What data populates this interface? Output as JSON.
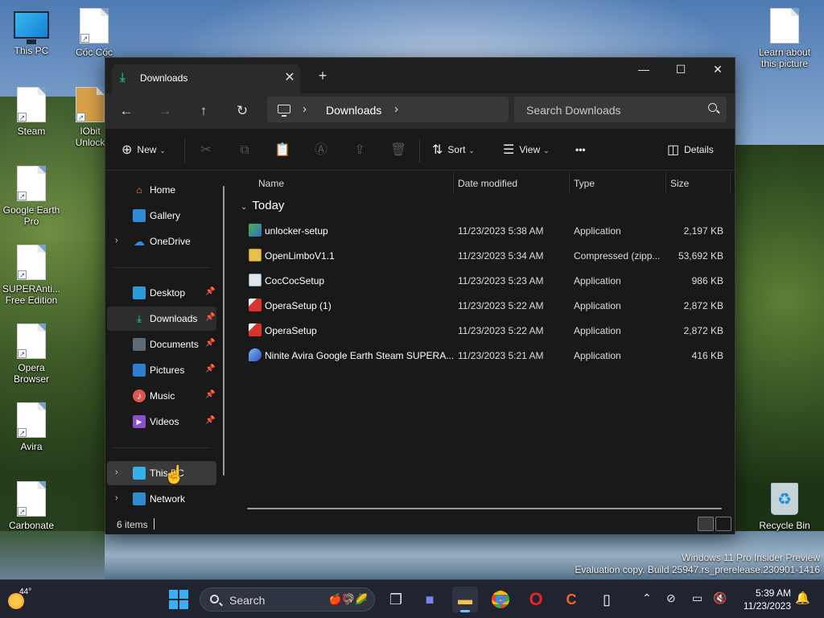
{
  "desktop": {
    "icons": [
      {
        "label": "This PC"
      },
      {
        "label": "Cốc Cốc"
      },
      {
        "label": "Steam"
      },
      {
        "label": "IObit Unlock"
      },
      {
        "label": "Google Earth Pro"
      },
      {
        "label": "SUPERAnti... Free Edition"
      },
      {
        "label": "Opera Browser"
      },
      {
        "label": "Avira"
      },
      {
        "label": "Carbonate"
      },
      {
        "label": "Learn about this picture"
      },
      {
        "label": "Recycle Bin"
      }
    ],
    "watermark": {
      "line1": "Windows 11 Pro Insider Preview",
      "line2": "Evaluation copy. Build 25947.rs_prerelease.230901-1416"
    }
  },
  "window": {
    "tab_title": "Downloads",
    "new_tab": "+",
    "controls": {
      "minimize": "—",
      "maximize": "☐",
      "close": "✕"
    },
    "address": {
      "crumb": "Downloads"
    },
    "search": {
      "placeholder": "Search Downloads"
    },
    "commands": {
      "new": "New",
      "sort": "Sort",
      "view": "View",
      "more": "•••",
      "details": "Details"
    },
    "sidebar": {
      "top": [
        {
          "label": "Home",
          "icon": "home-icon"
        },
        {
          "label": "Gallery",
          "icon": "gallery-icon"
        },
        {
          "label": "OneDrive",
          "icon": "cloud-icon"
        }
      ],
      "quick": [
        {
          "label": "Desktop",
          "icon": "desktop-icon"
        },
        {
          "label": "Downloads",
          "icon": "download-icon"
        },
        {
          "label": "Documents",
          "icon": "documents-icon"
        },
        {
          "label": "Pictures",
          "icon": "pictures-icon"
        },
        {
          "label": "Music",
          "icon": "music-icon"
        },
        {
          "label": "Videos",
          "icon": "videos-icon"
        }
      ],
      "bottom": [
        {
          "label": "This PC",
          "icon": "pc-icon"
        },
        {
          "label": "Network",
          "icon": "network-icon"
        }
      ]
    },
    "columns": {
      "name": "Name",
      "date": "Date modified",
      "type": "Type",
      "size": "Size"
    },
    "group": "Today",
    "files": [
      {
        "name": "unlocker-setup",
        "date": "11/23/2023 5:38 AM",
        "type": "Application",
        "size": "2,197 KB",
        "icon": "unlocker-icon"
      },
      {
        "name": "OpenLimboV1.1",
        "date": "11/23/2023 5:34 AM",
        "type": "Compressed (zipp...",
        "size": "53,692 KB",
        "icon": "zip-folder-icon"
      },
      {
        "name": "CocCocSetup",
        "date": "11/23/2023 5:23 AM",
        "type": "Application",
        "size": "986 KB",
        "icon": "setup-icon"
      },
      {
        "name": "OperaSetup (1)",
        "date": "11/23/2023 5:22 AM",
        "type": "Application",
        "size": "2,872 KB",
        "icon": "opera-setup-icon"
      },
      {
        "name": "OperaSetup",
        "date": "11/23/2023 5:22 AM",
        "type": "Application",
        "size": "2,872 KB",
        "icon": "opera-setup-icon"
      },
      {
        "name": "Ninite Avira Google Earth Steam SUPERA...",
        "date": "11/23/2023 5:21 AM",
        "type": "Application",
        "size": "416 KB",
        "icon": "ninite-icon"
      }
    ],
    "status": {
      "items": "6 items"
    }
  },
  "taskbar": {
    "weather_temp": "44°",
    "search_label": "Search",
    "time": "5:39 AM",
    "date": "11/23/2023"
  }
}
